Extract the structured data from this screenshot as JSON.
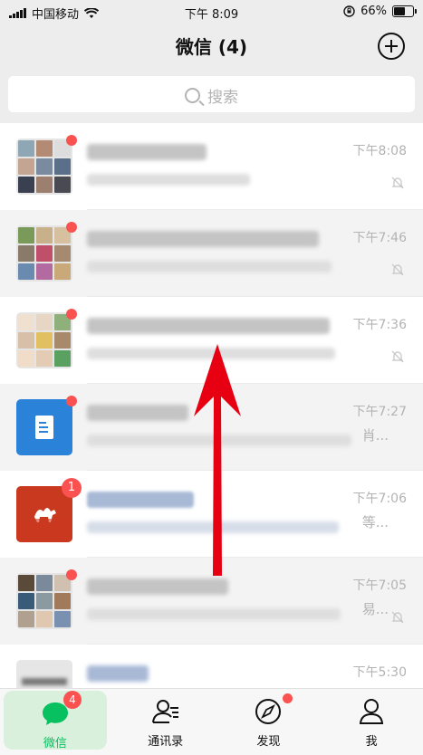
{
  "status_bar": {
    "carrier": "中国移动",
    "time": "下午 8:09",
    "battery": "66%",
    "battery_level": 0.66
  },
  "header": {
    "title": "微信 (4)"
  },
  "search": {
    "placeholder": "搜索"
  },
  "chats": [
    {
      "time": "下午8:08",
      "muted": true,
      "unread_dot": true
    },
    {
      "time": "下午7:46",
      "muted": true,
      "unread_dot": true
    },
    {
      "time": "下午7:36",
      "muted": true,
      "unread_dot": true
    },
    {
      "time": "下午7:27",
      "muted": false,
      "unread_dot": true,
      "preview_tail": "肖..."
    },
    {
      "time": "下午7:06",
      "muted": false,
      "unread_count": "1",
      "name_visible": "CAMEL 驼翎",
      "preview_tail": "等..."
    },
    {
      "time": "下午7:05",
      "muted": true,
      "unread_dot": true,
      "preview_tail": "易..."
    },
    {
      "time": "下午5:30",
      "muted": false
    }
  ],
  "tabbar": {
    "tabs": [
      {
        "label": "微信",
        "badge": "4",
        "icon": "chat-bubble-icon",
        "active": true
      },
      {
        "label": "通讯录",
        "icon": "contacts-icon"
      },
      {
        "label": "发现",
        "icon": "compass-icon",
        "dot": true
      },
      {
        "label": "我",
        "icon": "person-icon"
      }
    ]
  },
  "colors": {
    "accent": "#07c160",
    "badge": "#fa5151",
    "arrow": "#e60012"
  }
}
